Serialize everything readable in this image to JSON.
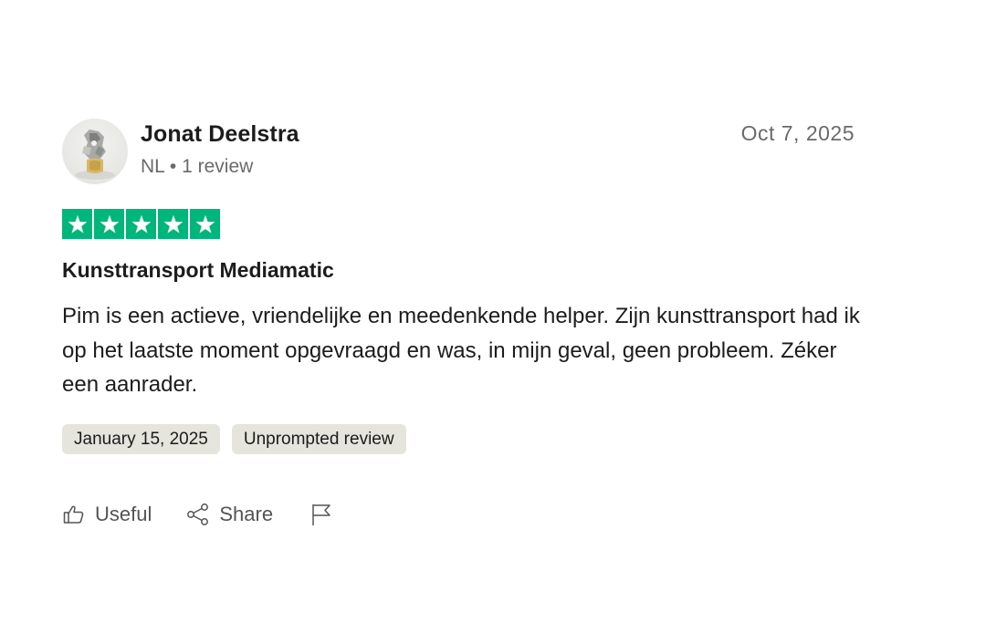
{
  "reviewer": {
    "name": "Jonat Deelstra",
    "country": "NL",
    "separator": "•",
    "review_count": "1 review"
  },
  "review": {
    "date": "Oct 7, 2025",
    "rating": 5,
    "max_rating": 5,
    "star_color": "#00b67a",
    "title": "Kunsttransport Mediamatic",
    "text": "Pim is een actieve, vriendelijke en meedenkende helper. Zijn kunsttransport had ik op het laatste moment opgevraagd en was, in mijn geval, geen probleem. Zéker een aanrader."
  },
  "tags": {
    "experience_date": "January 15, 2025",
    "type": "Unprompted review"
  },
  "actions": {
    "useful_label": "Useful",
    "share_label": "Share",
    "useful_icon": "thumbs-up-icon",
    "share_icon": "share-icon",
    "flag_icon": "flag-icon"
  }
}
